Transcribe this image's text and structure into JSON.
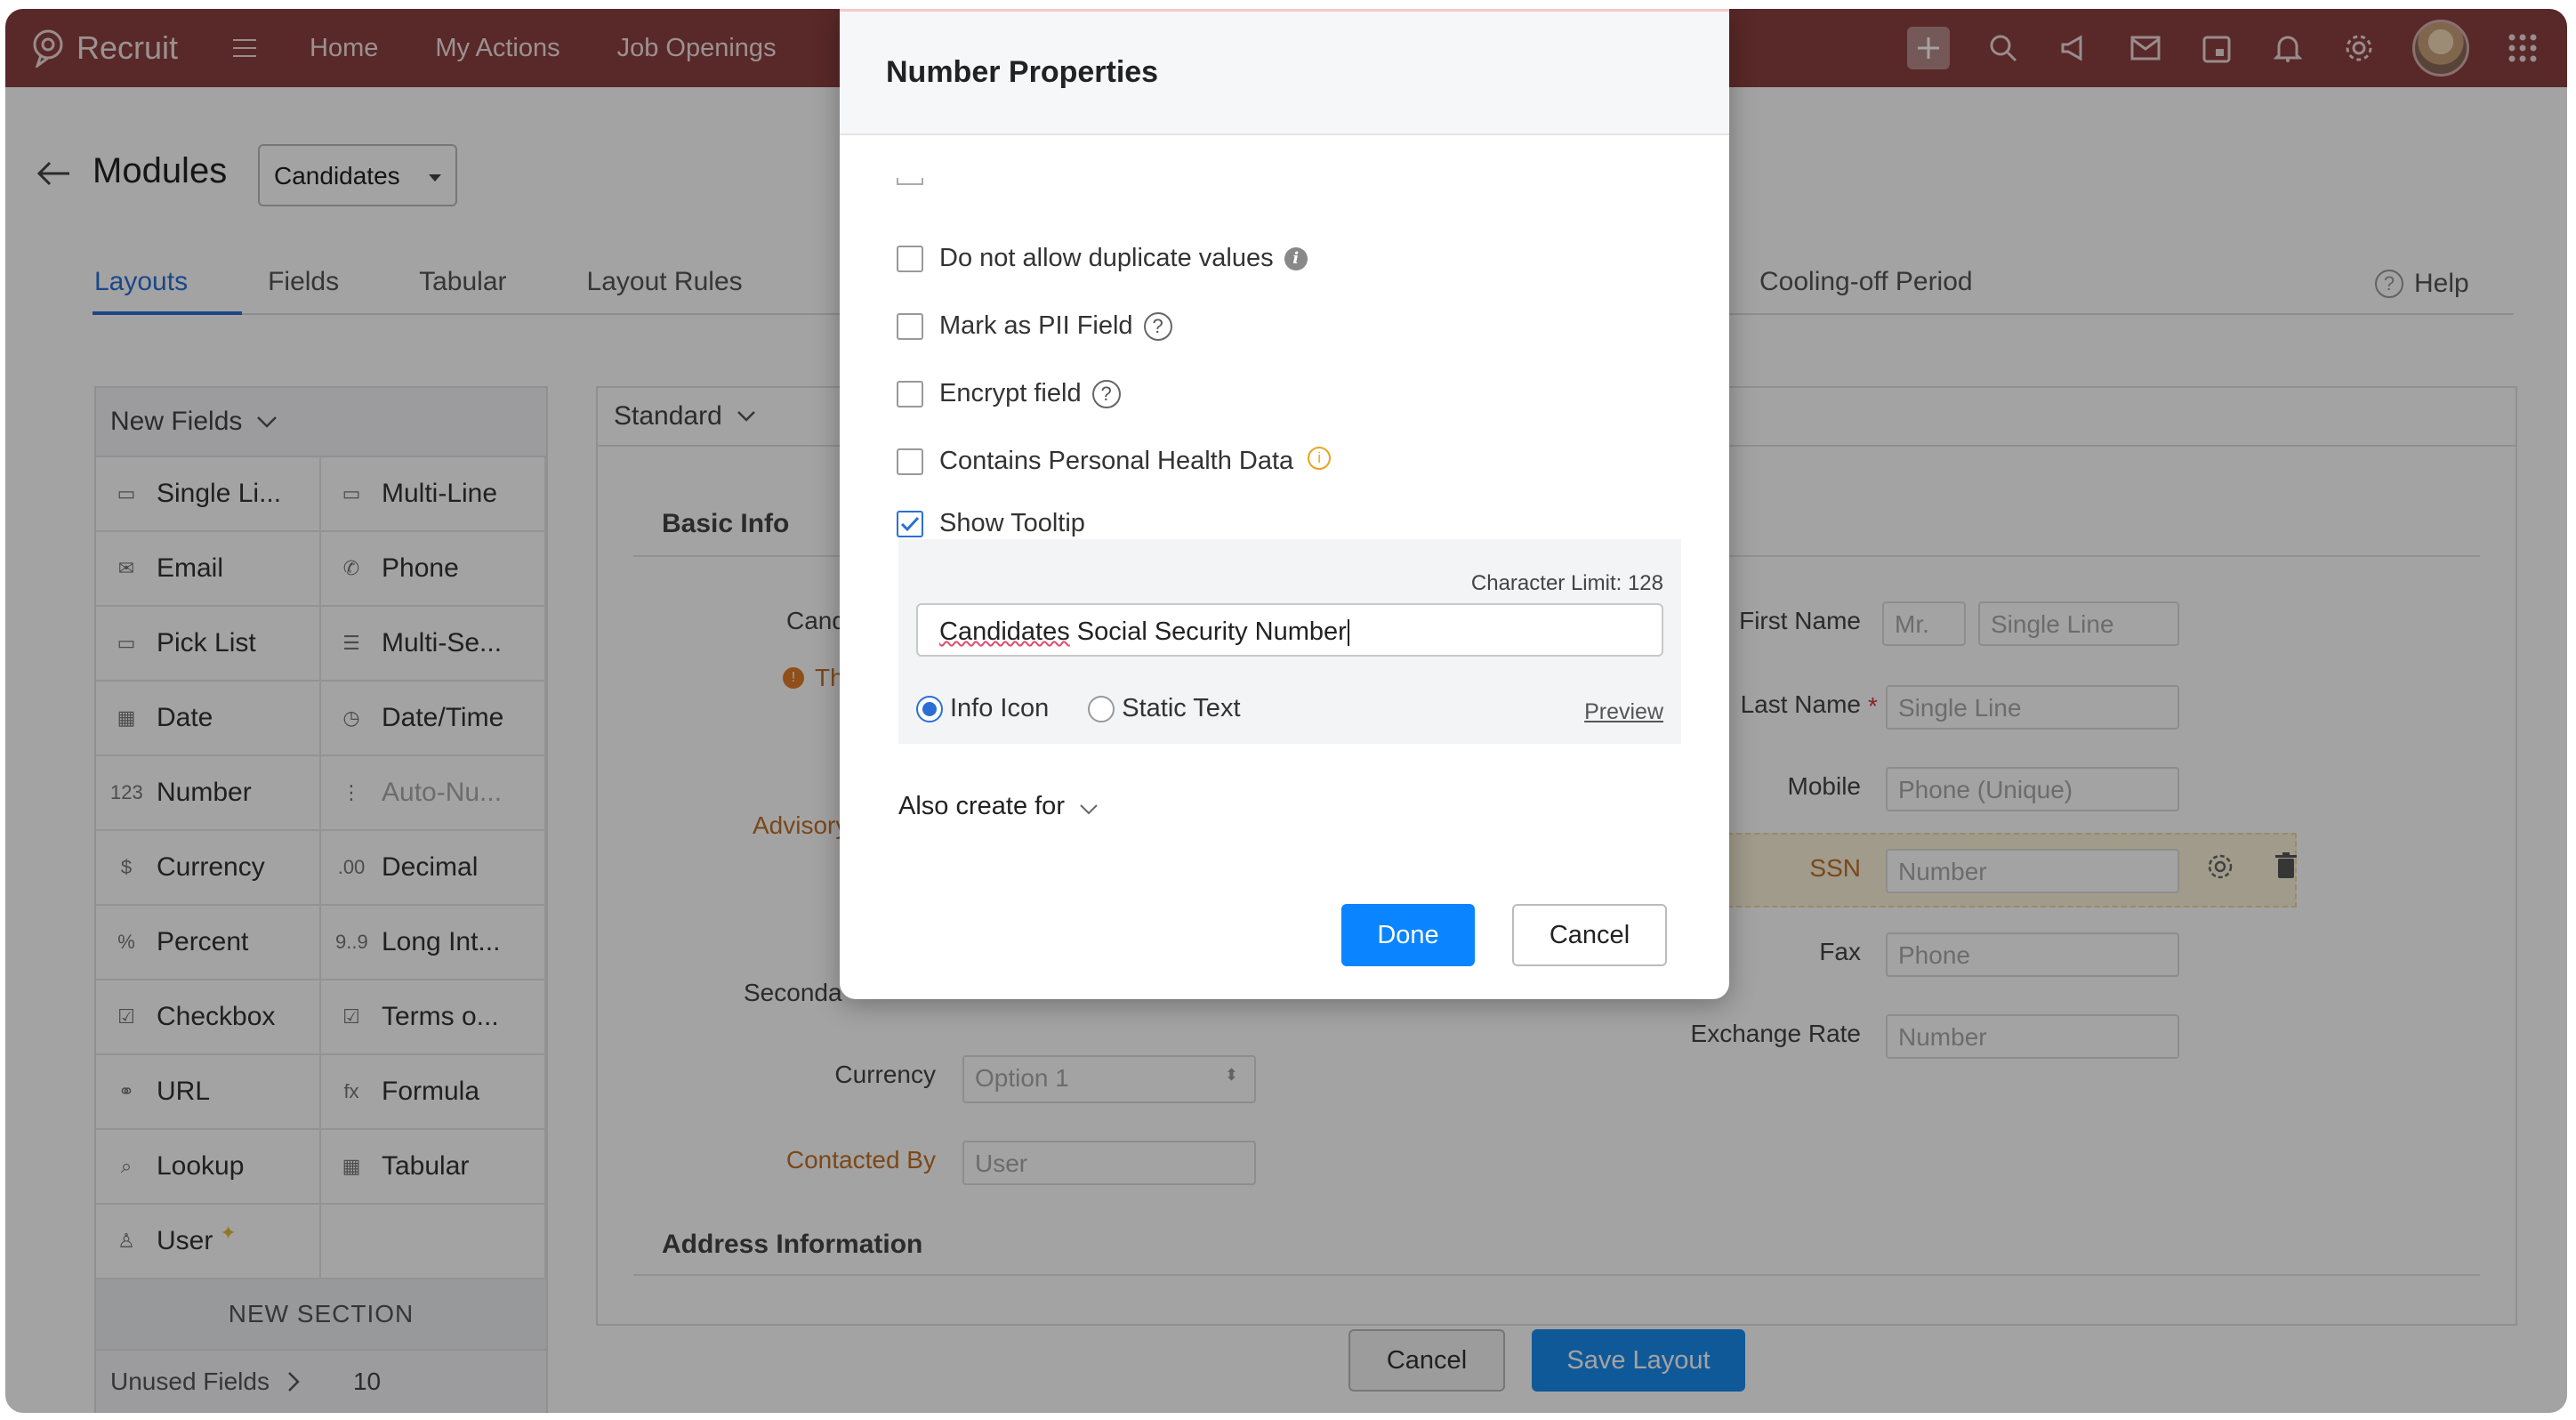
{
  "app": {
    "name": "Recruit"
  },
  "nav": {
    "items": [
      "Home",
      "My Actions",
      "Job Openings"
    ]
  },
  "header": {
    "title": "Modules",
    "module_selected": "Candidates"
  },
  "tabs": [
    "Layouts",
    "Fields",
    "Tabular",
    "Layout Rules"
  ],
  "tab_right": "Cooling-off Period",
  "help_label": "Help",
  "palette": {
    "title": "New Fields",
    "fields": [
      {
        "label": "Single Li...",
        "icon": "single-line-icon",
        "glyph": "▭"
      },
      {
        "label": "Multi-Line",
        "icon": "multi-line-icon",
        "glyph": "▭"
      },
      {
        "label": "Email",
        "icon": "email-icon",
        "glyph": "✉"
      },
      {
        "label": "Phone",
        "icon": "phone-icon",
        "glyph": "✆"
      },
      {
        "label": "Pick List",
        "icon": "pick-list-icon",
        "glyph": "▭"
      },
      {
        "label": "Multi-Se...",
        "icon": "multi-select-icon",
        "glyph": "☰"
      },
      {
        "label": "Date",
        "icon": "date-icon",
        "glyph": "▦"
      },
      {
        "label": "Date/Time",
        "icon": "date-time-icon",
        "glyph": "◷"
      },
      {
        "label": "Number",
        "icon": "number-icon",
        "glyph": "123"
      },
      {
        "label": "Auto-Nu...",
        "icon": "auto-number-icon",
        "glyph": "⋮"
      },
      {
        "label": "Currency",
        "icon": "currency-icon",
        "glyph": "$"
      },
      {
        "label": "Decimal",
        "icon": "decimal-icon",
        "glyph": ".00"
      },
      {
        "label": "Percent",
        "icon": "percent-icon",
        "glyph": "%"
      },
      {
        "label": "Long Int...",
        "icon": "long-integer-icon",
        "glyph": "9..9"
      },
      {
        "label": "Checkbox",
        "icon": "checkbox-icon",
        "glyph": "☑"
      },
      {
        "label": "Terms o...",
        "icon": "terms-icon",
        "glyph": "☑"
      },
      {
        "label": "URL",
        "icon": "url-icon",
        "glyph": "⚭"
      },
      {
        "label": "Formula",
        "icon": "formula-icon",
        "glyph": "fx"
      },
      {
        "label": "Lookup",
        "icon": "lookup-icon",
        "glyph": "⌕"
      },
      {
        "label": "Tabular",
        "icon": "tabular-icon",
        "glyph": "▦"
      },
      {
        "label": "User",
        "icon": "user-icon",
        "glyph": "♙"
      },
      {
        "label": "",
        "icon": "",
        "glyph": ""
      }
    ],
    "new_section": "NEW SECTION",
    "unused_label": "Unused Fields",
    "unused_count": "10"
  },
  "canvas": {
    "layout_name": "Standard",
    "section_title": "Basic Info",
    "left_fields": {
      "cand": "Cand",
      "thi": "Thi",
      "advisory": "Advisory",
      "seconda": "Seconda",
      "currency_label": "Currency",
      "currency_value": "Option 1",
      "contacted_by_label": "Contacted By",
      "contacted_by_value": "User"
    },
    "right_fields": {
      "first_name_label": "First Name",
      "salutation": "Mr.",
      "first_name_placeholder": "Single Line",
      "last_name_label": "Last Name",
      "last_name_placeholder": "Single Line",
      "mobile_label": "Mobile",
      "mobile_placeholder": "Phone (Unique)",
      "ssn_label": "SSN",
      "ssn_placeholder": "Number",
      "fax_label": "Fax",
      "fax_placeholder": "Phone",
      "exchange_label": "Exchange Rate",
      "exchange_placeholder": "Number"
    },
    "address_title": "Address Information"
  },
  "footer": {
    "cancel": "Cancel",
    "save": "Save Layout"
  },
  "modal": {
    "title": "Number Properties",
    "options": [
      {
        "label": "Do not allow duplicate values",
        "checked": false,
        "badge": "info-dark"
      },
      {
        "label": "Mark as PII Field",
        "checked": false,
        "badge": "question"
      },
      {
        "label": "Encrypt field",
        "checked": false,
        "badge": "question"
      },
      {
        "label": "Contains Personal Health Data",
        "checked": false,
        "badge": "info-orange"
      },
      {
        "label": "Show Tooltip",
        "checked": true,
        "badge": ""
      }
    ],
    "char_limit": "Character Limit: 128",
    "tooltip_word1": "Candidates",
    "tooltip_rest": " Social Security Number",
    "radio_info": "Info Icon",
    "radio_static": "Static Text",
    "preview": "Preview",
    "also_create": "Also create for",
    "done": "Done",
    "cancel": "Cancel"
  },
  "colors": {
    "topbar": "#8b3f3f",
    "primary": "#0a84ff",
    "accent": "#2b6fd6"
  }
}
